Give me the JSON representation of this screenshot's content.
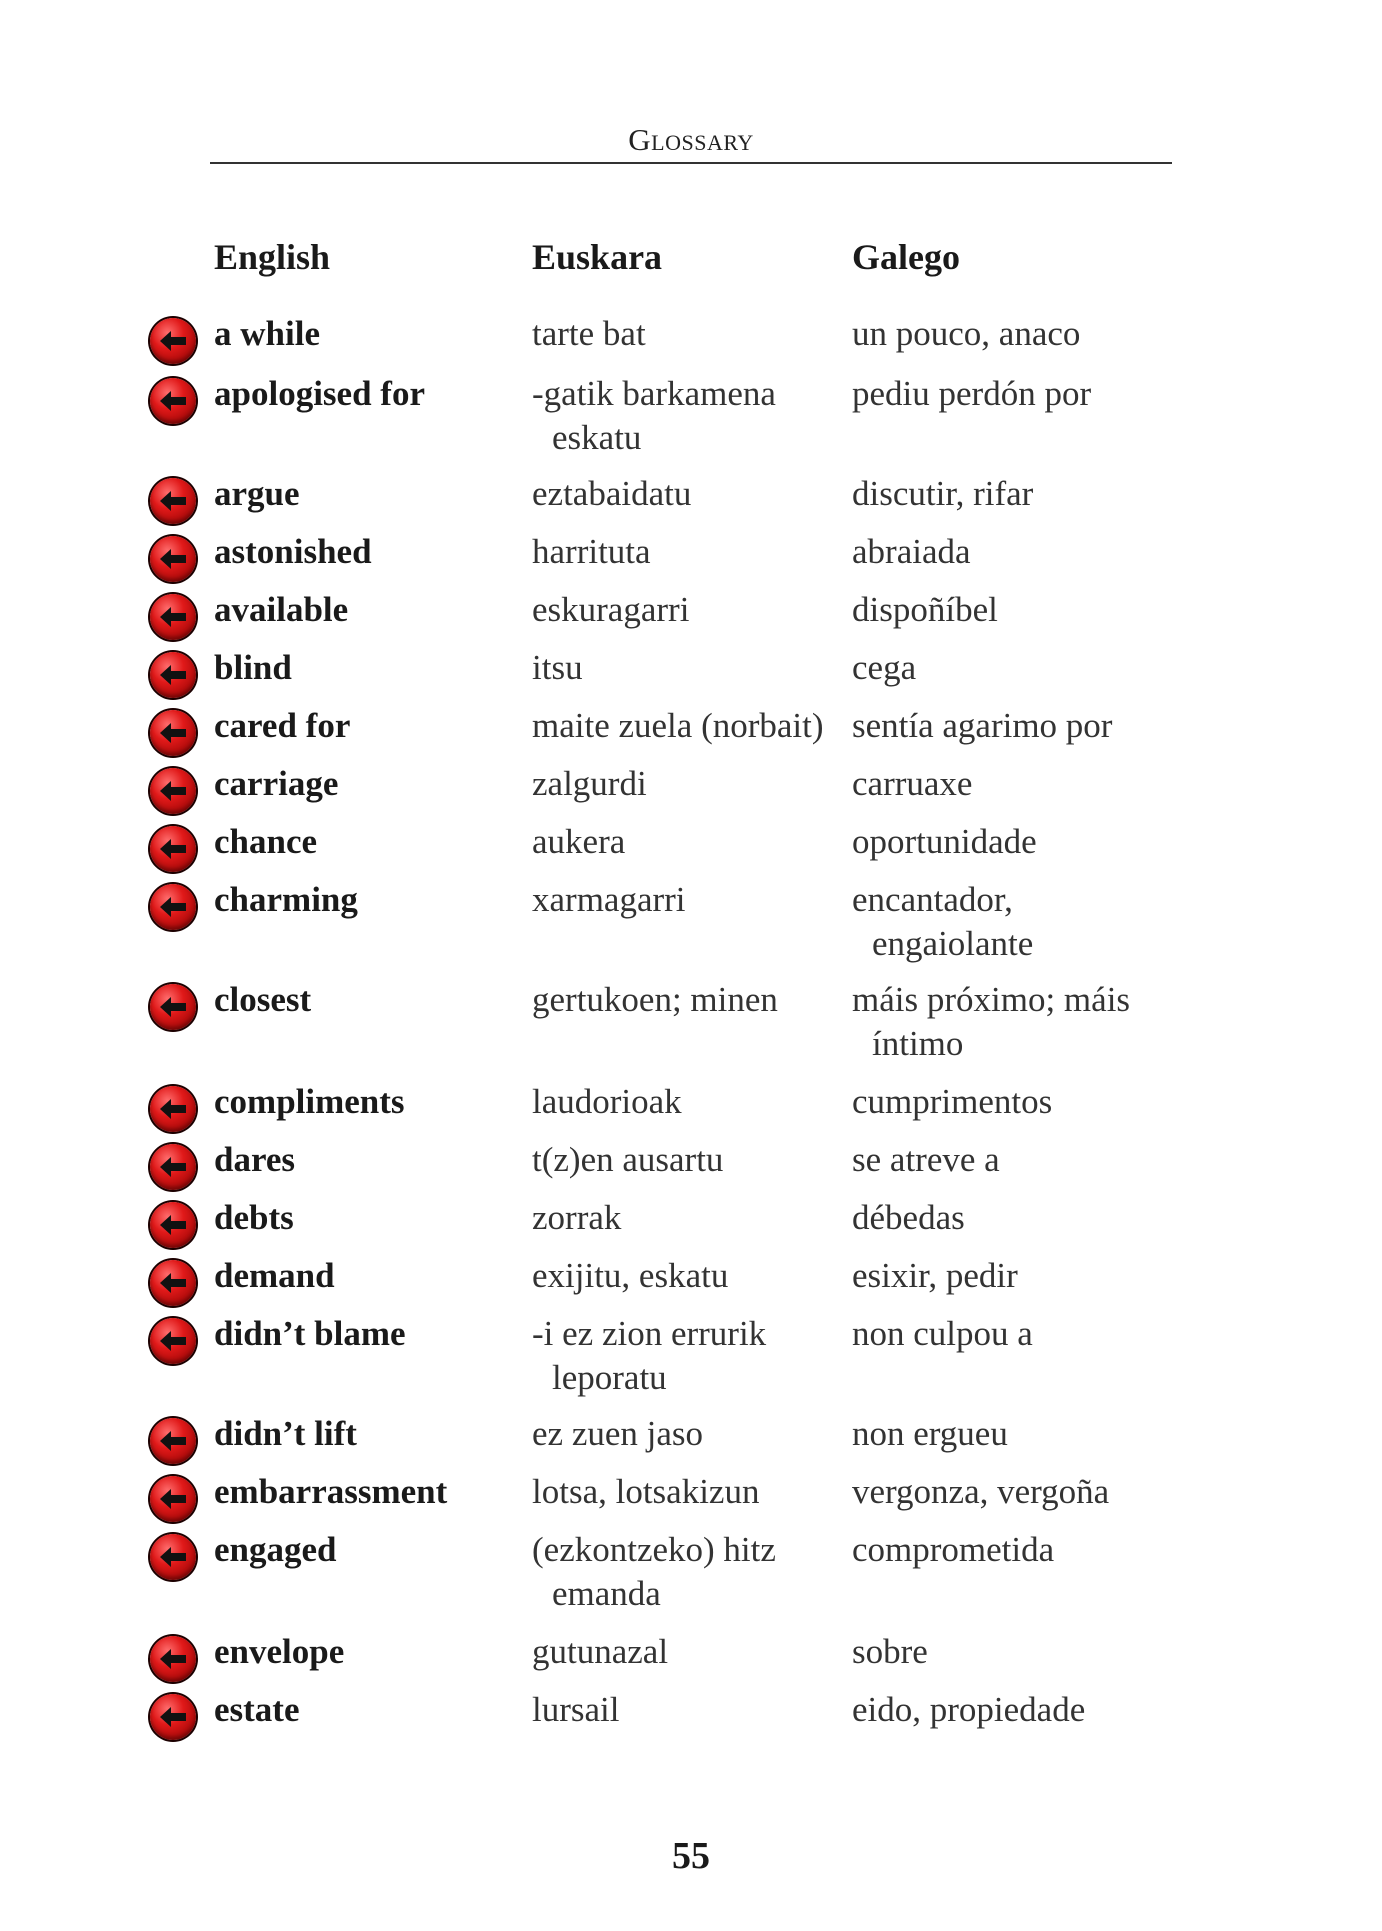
{
  "header": {
    "title": "Glossary"
  },
  "columns": {
    "english": "English",
    "euskara": "Euskara",
    "galego": "Galego"
  },
  "entries": [
    {
      "en": "a while",
      "eu": "tarte bat",
      "eu2": "",
      "ga": "un pouco, anaco",
      "ga2": ""
    },
    {
      "en": "apologised for",
      "eu": "-gatik barkamena",
      "eu2": "eskatu",
      "ga": "pediu perdón por",
      "ga2": ""
    },
    {
      "en": "argue",
      "eu": "eztabaidatu",
      "eu2": "",
      "ga": "discutir, rifar",
      "ga2": ""
    },
    {
      "en": "astonished",
      "eu": "harrituta",
      "eu2": "",
      "ga": "abraiada",
      "ga2": ""
    },
    {
      "en": "available",
      "eu": "eskuragarri",
      "eu2": "",
      "ga": "dispoñíbel",
      "ga2": ""
    },
    {
      "en": "blind",
      "eu": "itsu",
      "eu2": "",
      "ga": "cega",
      "ga2": ""
    },
    {
      "en": "cared for",
      "eu": "maite zuela (norbait)",
      "eu2": "",
      "ga": "sentía agarimo por",
      "ga2": ""
    },
    {
      "en": "carriage",
      "eu": "zalgurdi",
      "eu2": "",
      "ga": "carruaxe",
      "ga2": ""
    },
    {
      "en": "chance",
      "eu": "aukera",
      "eu2": "",
      "ga": "oportunidade",
      "ga2": ""
    },
    {
      "en": "charming",
      "eu": "xarmagarri",
      "eu2": "",
      "ga": "encantador,",
      "ga2": "engaiolante"
    },
    {
      "en": "closest",
      "eu": "gertukoen; minen",
      "eu2": "",
      "ga": "máis próximo; máis",
      "ga2": "íntimo"
    },
    {
      "en": "compliments",
      "eu": "laudorioak",
      "eu2": "",
      "ga": "cumprimentos",
      "ga2": ""
    },
    {
      "en": "dares",
      "eu": "t(z)en ausartu",
      "eu2": "",
      "ga": "se atreve a",
      "ga2": ""
    },
    {
      "en": "debts",
      "eu": "zorrak",
      "eu2": "",
      "ga": "débedas",
      "ga2": ""
    },
    {
      "en": "demand",
      "eu": "exijitu, eskatu",
      "eu2": "",
      "ga": "esixir, pedir",
      "ga2": ""
    },
    {
      "en": "didn’t blame",
      "eu": "-i ez zion errurik",
      "eu2": "leporatu",
      "ga": "non culpou a",
      "ga2": ""
    },
    {
      "en": "didn’t lift",
      "eu": "ez zuen jaso",
      "eu2": "",
      "ga": "non ergueu",
      "ga2": ""
    },
    {
      "en": "embarrassment",
      "eu": "lotsa, lotsakizun",
      "eu2": "",
      "ga": "vergonza, vergoña",
      "ga2": ""
    },
    {
      "en": "engaged",
      "eu": "(ezkontzeko) hitz",
      "eu2": "emanda",
      "ga": "comprometida",
      "ga2": ""
    },
    {
      "en": "envelope",
      "eu": "gutunazal",
      "eu2": "",
      "ga": "sobre",
      "ga2": ""
    },
    {
      "en": "estate",
      "eu": "lursail",
      "eu2": "",
      "ga": "eido, propiedade",
      "ga2": ""
    }
  ],
  "page_number": "55",
  "colors": {
    "audio_button": "#d41414",
    "rule": "#333333"
  },
  "icons": {
    "audio_button": "left-arrow-icon"
  }
}
